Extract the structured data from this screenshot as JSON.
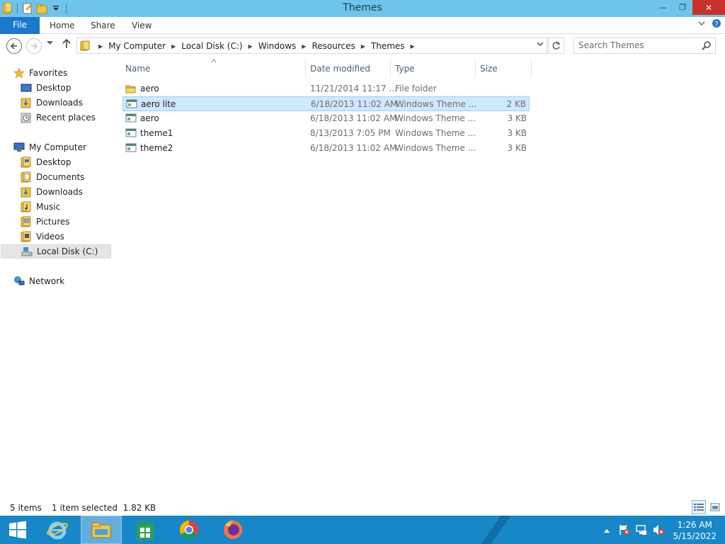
{
  "window": {
    "title": "Themes",
    "controls": {
      "minimize": "—",
      "restore": "❐",
      "close": "✕"
    }
  },
  "ribbon": {
    "file_label": "File",
    "tabs": [
      "Home",
      "Share",
      "View"
    ]
  },
  "address": {
    "crumbs": [
      "My Computer",
      "Local Disk (C:)",
      "Windows",
      "Resources",
      "Themes"
    ]
  },
  "search": {
    "placeholder": "Search Themes"
  },
  "nav": {
    "favorites": {
      "label": "Favorites",
      "items": [
        "Desktop",
        "Downloads",
        "Recent places"
      ]
    },
    "computer": {
      "label": "My Computer",
      "items": [
        "Desktop",
        "Documents",
        "Downloads",
        "Music",
        "Pictures",
        "Videos",
        "Local Disk (C:)"
      ]
    },
    "network": {
      "label": "Network"
    }
  },
  "columns": {
    "name": "Name",
    "date": "Date modified",
    "type": "Type",
    "size": "Size"
  },
  "files": [
    {
      "name": "aero",
      "date": "11/21/2014 11:17 ...",
      "type": "File folder",
      "size": "",
      "icon": "folder-icon"
    },
    {
      "name": "aero lite",
      "date": "6/18/2013 11:02 AM",
      "type": "Windows Theme ...",
      "size": "2 KB",
      "icon": "theme-file-icon"
    },
    {
      "name": "aero",
      "date": "6/18/2013 11:02 AM",
      "type": "Windows Theme ...",
      "size": "3 KB",
      "icon": "theme-file-icon"
    },
    {
      "name": "theme1",
      "date": "8/13/2013 7:05 PM",
      "type": "Windows Theme ...",
      "size": "3 KB",
      "icon": "theme-file-icon"
    },
    {
      "name": "theme2",
      "date": "6/18/2013 11:02 AM",
      "type": "Windows Theme ...",
      "size": "3 KB",
      "icon": "theme-file-icon"
    }
  ],
  "status": {
    "count": "5 items",
    "selection": "1 item selected  1.82 KB"
  },
  "clock": {
    "time": "1:26 AM",
    "date": "5/15/2022"
  },
  "colors": {
    "titlebar": "#6ec5e9",
    "file_tab": "#1979ca",
    "close": "#c7312b",
    "taskbar": "#1887c7",
    "selection": "#cde8ff"
  }
}
